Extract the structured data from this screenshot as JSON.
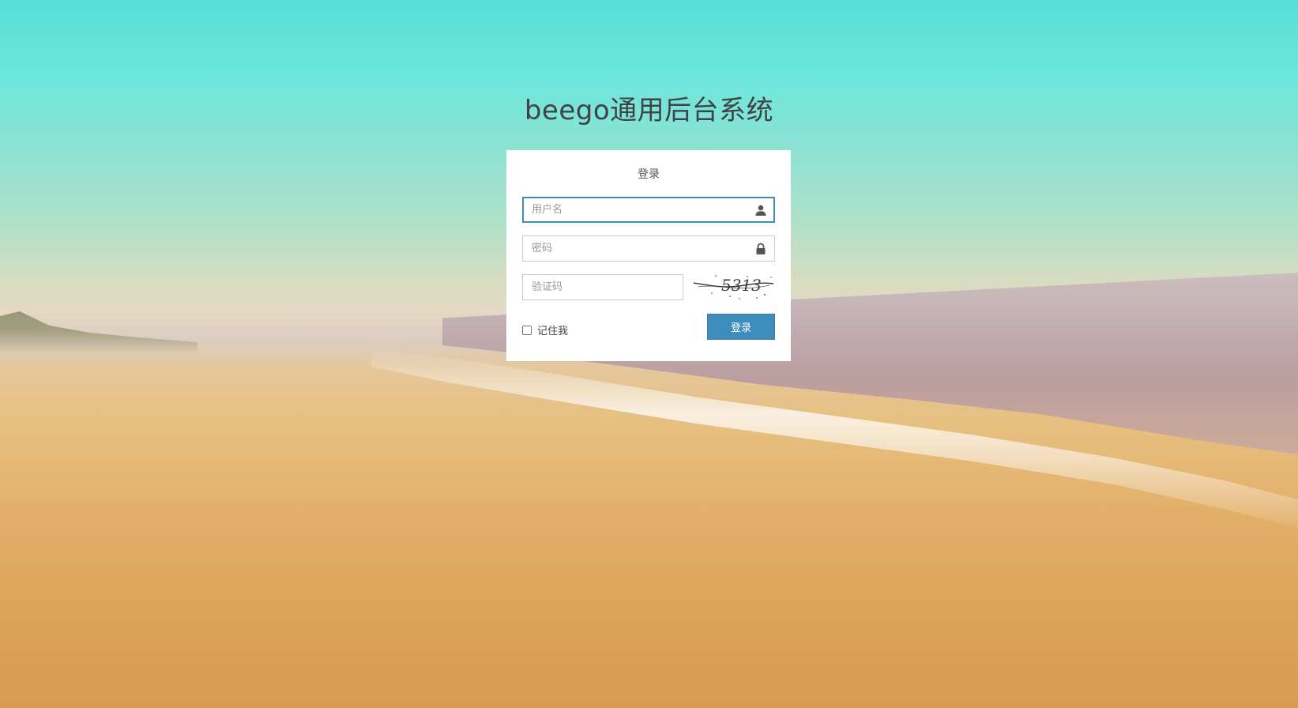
{
  "page": {
    "title": "beego通用后台系统"
  },
  "login": {
    "heading": "登录",
    "username_placeholder": "用户名",
    "password_placeholder": "密码",
    "captcha_placeholder": "验证码",
    "captcha_text": "5313",
    "remember_label": "记住我",
    "submit_label": "登录"
  },
  "icons": {
    "username": "user-icon",
    "password": "lock-icon"
  },
  "colors": {
    "primary": "#3c8dbc",
    "focus_border": "#3c8dbc",
    "title_text": "#3f4345"
  }
}
